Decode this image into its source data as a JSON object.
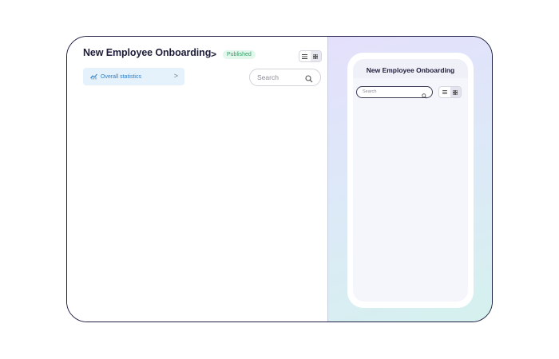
{
  "editor": {
    "title": "New Employee Onboarding",
    "breadcrumb_chevron": ">",
    "status_badge": "Published",
    "stats_button": {
      "label": "Overall statistics",
      "chevron": ">"
    },
    "search": {
      "placeholder": "Search"
    },
    "view_toggle": [
      "list-view-icon",
      "grid-view-icon"
    ]
  },
  "preview": {
    "title": "New Employee Onboarding",
    "search": {
      "placeholder": "Search"
    },
    "view_toggle": [
      "list-view-icon",
      "grid-view-icon"
    ]
  },
  "colors": {
    "frame_border": "#1e1e44",
    "badge_bg": "#e3f7ec",
    "badge_text": "#23a562",
    "stats_bg": "#e5f1fb",
    "stats_text": "#2e7ec4",
    "preview_gradient_start": "#e4e0fb",
    "preview_gradient_end": "#d5f1ee"
  }
}
